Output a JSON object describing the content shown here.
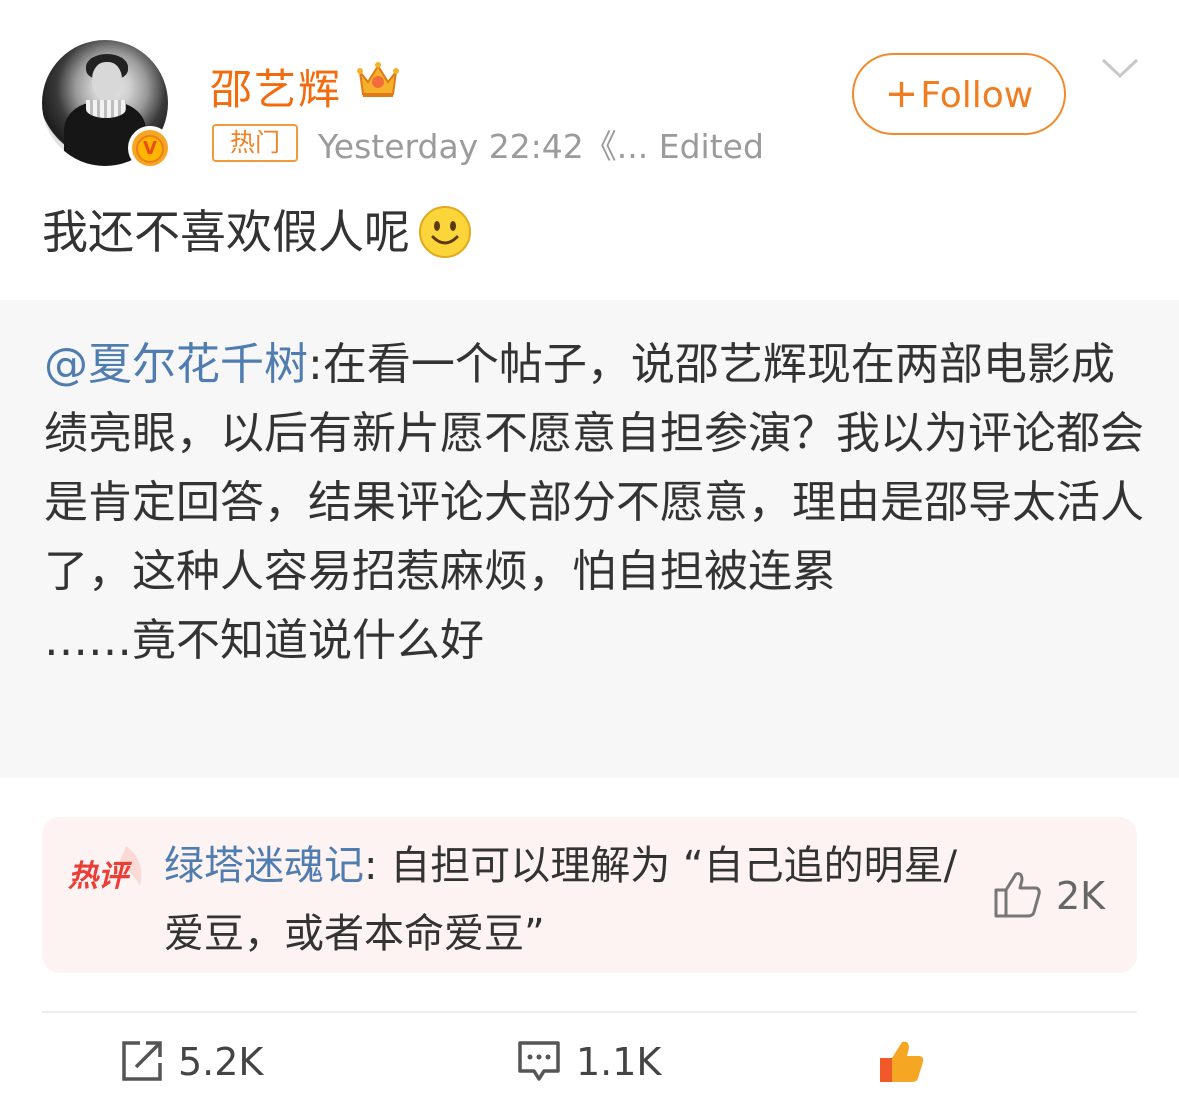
{
  "author": {
    "name": "邵艺辉",
    "hot_tag": "热门",
    "meta": "Yesterday 22:42《...  Edited",
    "verified_badge": "V"
  },
  "follow_button": {
    "plus": "+",
    "label": "Follow"
  },
  "post": {
    "text": "我还不喜欢假人呢",
    "emoji": "smile-emoji"
  },
  "repost": {
    "mention": "@夏尔花千树",
    "text": ":在看一个帖子，说邵艺辉现在两部电影成绩亮眼，以后有新片愿不愿意自担参演？我以为评论都会是肯定回答，结果评论大部分不愿意，理由是邵导太活人了，这种人容易招惹麻烦，怕自担被连累",
    "text2": "……竟不知道说什么好"
  },
  "hot_comment": {
    "label": "热评",
    "user": "绿塔迷魂记",
    "text": ": 自担可以理解为 “自己追的明星/爱豆，或者本命爱豆”",
    "likes": "2K"
  },
  "actions": {
    "share_count": "5.2K",
    "comment_count": "1.1K",
    "like_count": ""
  },
  "colors": {
    "accent_orange": "#f07d1f",
    "link_blue": "#507daf",
    "meta_gray": "#9b9b9b"
  },
  "icons": [
    "crown-icon",
    "chevron-down-icon",
    "share-icon",
    "comment-icon",
    "like-icon",
    "smile-emoji",
    "hot-comment-icon"
  ]
}
